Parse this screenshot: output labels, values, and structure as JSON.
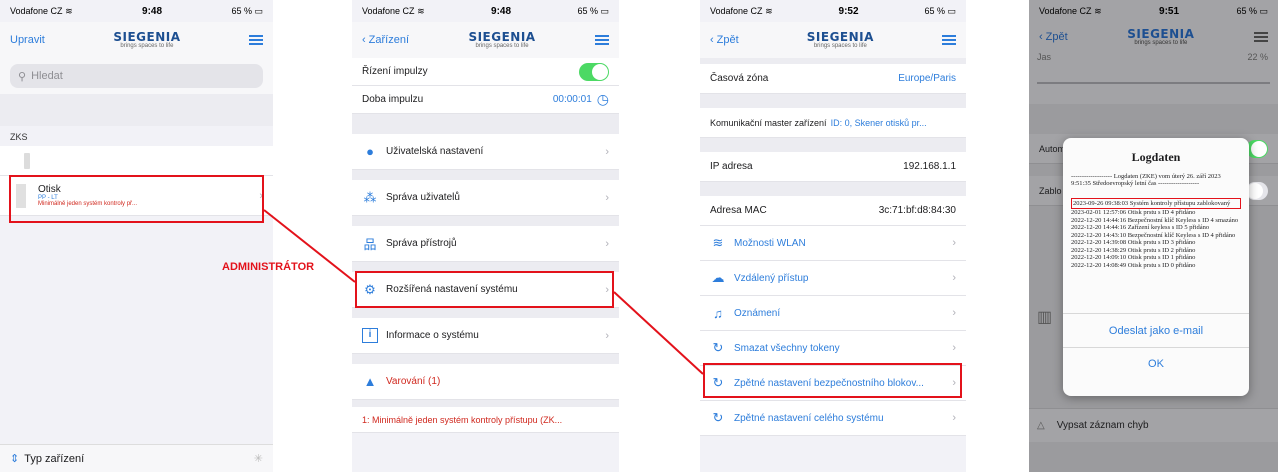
{
  "status": {
    "carrier": "Vodafone CZ",
    "time1": "9:48",
    "battery1": "65 %",
    "time2": "9:48",
    "battery2": "65 %",
    "time3": "9:52",
    "battery3": "65 %",
    "time4": "9:51",
    "battery4": "65 %"
  },
  "logo": {
    "brand": "SIEGENIA",
    "tagline": "brings spaces to life"
  },
  "screen1": {
    "edit": "Upravit",
    "search_placeholder": "Hledat",
    "section": "ZKS",
    "device_name": "Otisk",
    "device_sub": "PP - LT",
    "device_warning": "Minimálně jeden systém kontroly př...",
    "footer": "Typ zařízení"
  },
  "annotation": "ADMINISTRÁTOR",
  "screen2": {
    "back": "Zařízení",
    "impulse_control": "Řízení impulzy",
    "impulse_duration": "Doba impulzu",
    "impulse_value": "00:00:01",
    "user_settings": "Uživatelská nastavení",
    "user_management": "Správa uživatelů",
    "device_management": "Správa přístrojů",
    "advanced_settings": "Rozšířená nastavení systému",
    "system_info": "Informace o systému",
    "warnings": "Varování (1)",
    "warning_item": "1: Minimálně jeden systém kontroly přístupu (ZK..."
  },
  "screen3": {
    "back": "Zpět",
    "timezone_label": "Časová zóna",
    "timezone_value": "Europe/Paris",
    "master_label": "Komunikační master zařízení",
    "master_value": "ID: 0, Skener otisků pr...",
    "ip_label": "IP adresa",
    "ip_value": "192.168.1.1",
    "mac_label": "Adresa MAC",
    "mac_value": "3c:71:bf:d8:84:30",
    "wlan": "Možnosti WLAN",
    "remote": "Vzdálený přístup",
    "notifications": "Oznámení",
    "delete_tokens": "Smazat všechny tokeny",
    "reset_block": "Zpětné nastavení bezpečnostního blokov...",
    "reset_all": "Zpětné nastavení celého systému"
  },
  "screen4": {
    "back": "Zpět",
    "brightness": "Jas",
    "brightness_value": "22 %",
    "auto": "Autom",
    "block": "Zablo",
    "error_log": "Vypsat záznam chyb",
    "modal_title": "Logdaten",
    "log_header": "------------------- Logdaten (ZKE) vom úterý 26. září 2023 9:51:35 Středoevropský letní čas -------------------",
    "log_highlight": "2023-09-26 09:38:03 Systém kontroly přístupu zablokovaný",
    "log_lines": [
      "2023-02-01 12:57:06 Otisk prstu s ID 4 přidáno",
      "2022-12-20 14:44:16 Bezpečnostní klíč Keyless s ID 4 smazáno",
      "2022-12-20 14:44:16 Zařízení keyless s ID 5 přidáno",
      "2022-12-20 14:43:10 Bezpečnostní klíč Keyless s ID 4 přidáno",
      "2022-12-20 14:39:08 Otisk prstu s ID 3 přidáno",
      "2022-12-20 14:38:29 Otisk prstu s ID 2 přidáno",
      "2022-12-20 14:09:10 Otisk prstu s ID 1 přidáno",
      "2022-12-20 14:08:49 Otisk prstu s ID 0 přidáno"
    ],
    "send_email": "Odeslat jako e-mail",
    "ok": "OK"
  },
  "colors": {
    "accent": "#2d7ddb",
    "highlight": "#e3121b",
    "toggle_on": "#4cd964"
  }
}
